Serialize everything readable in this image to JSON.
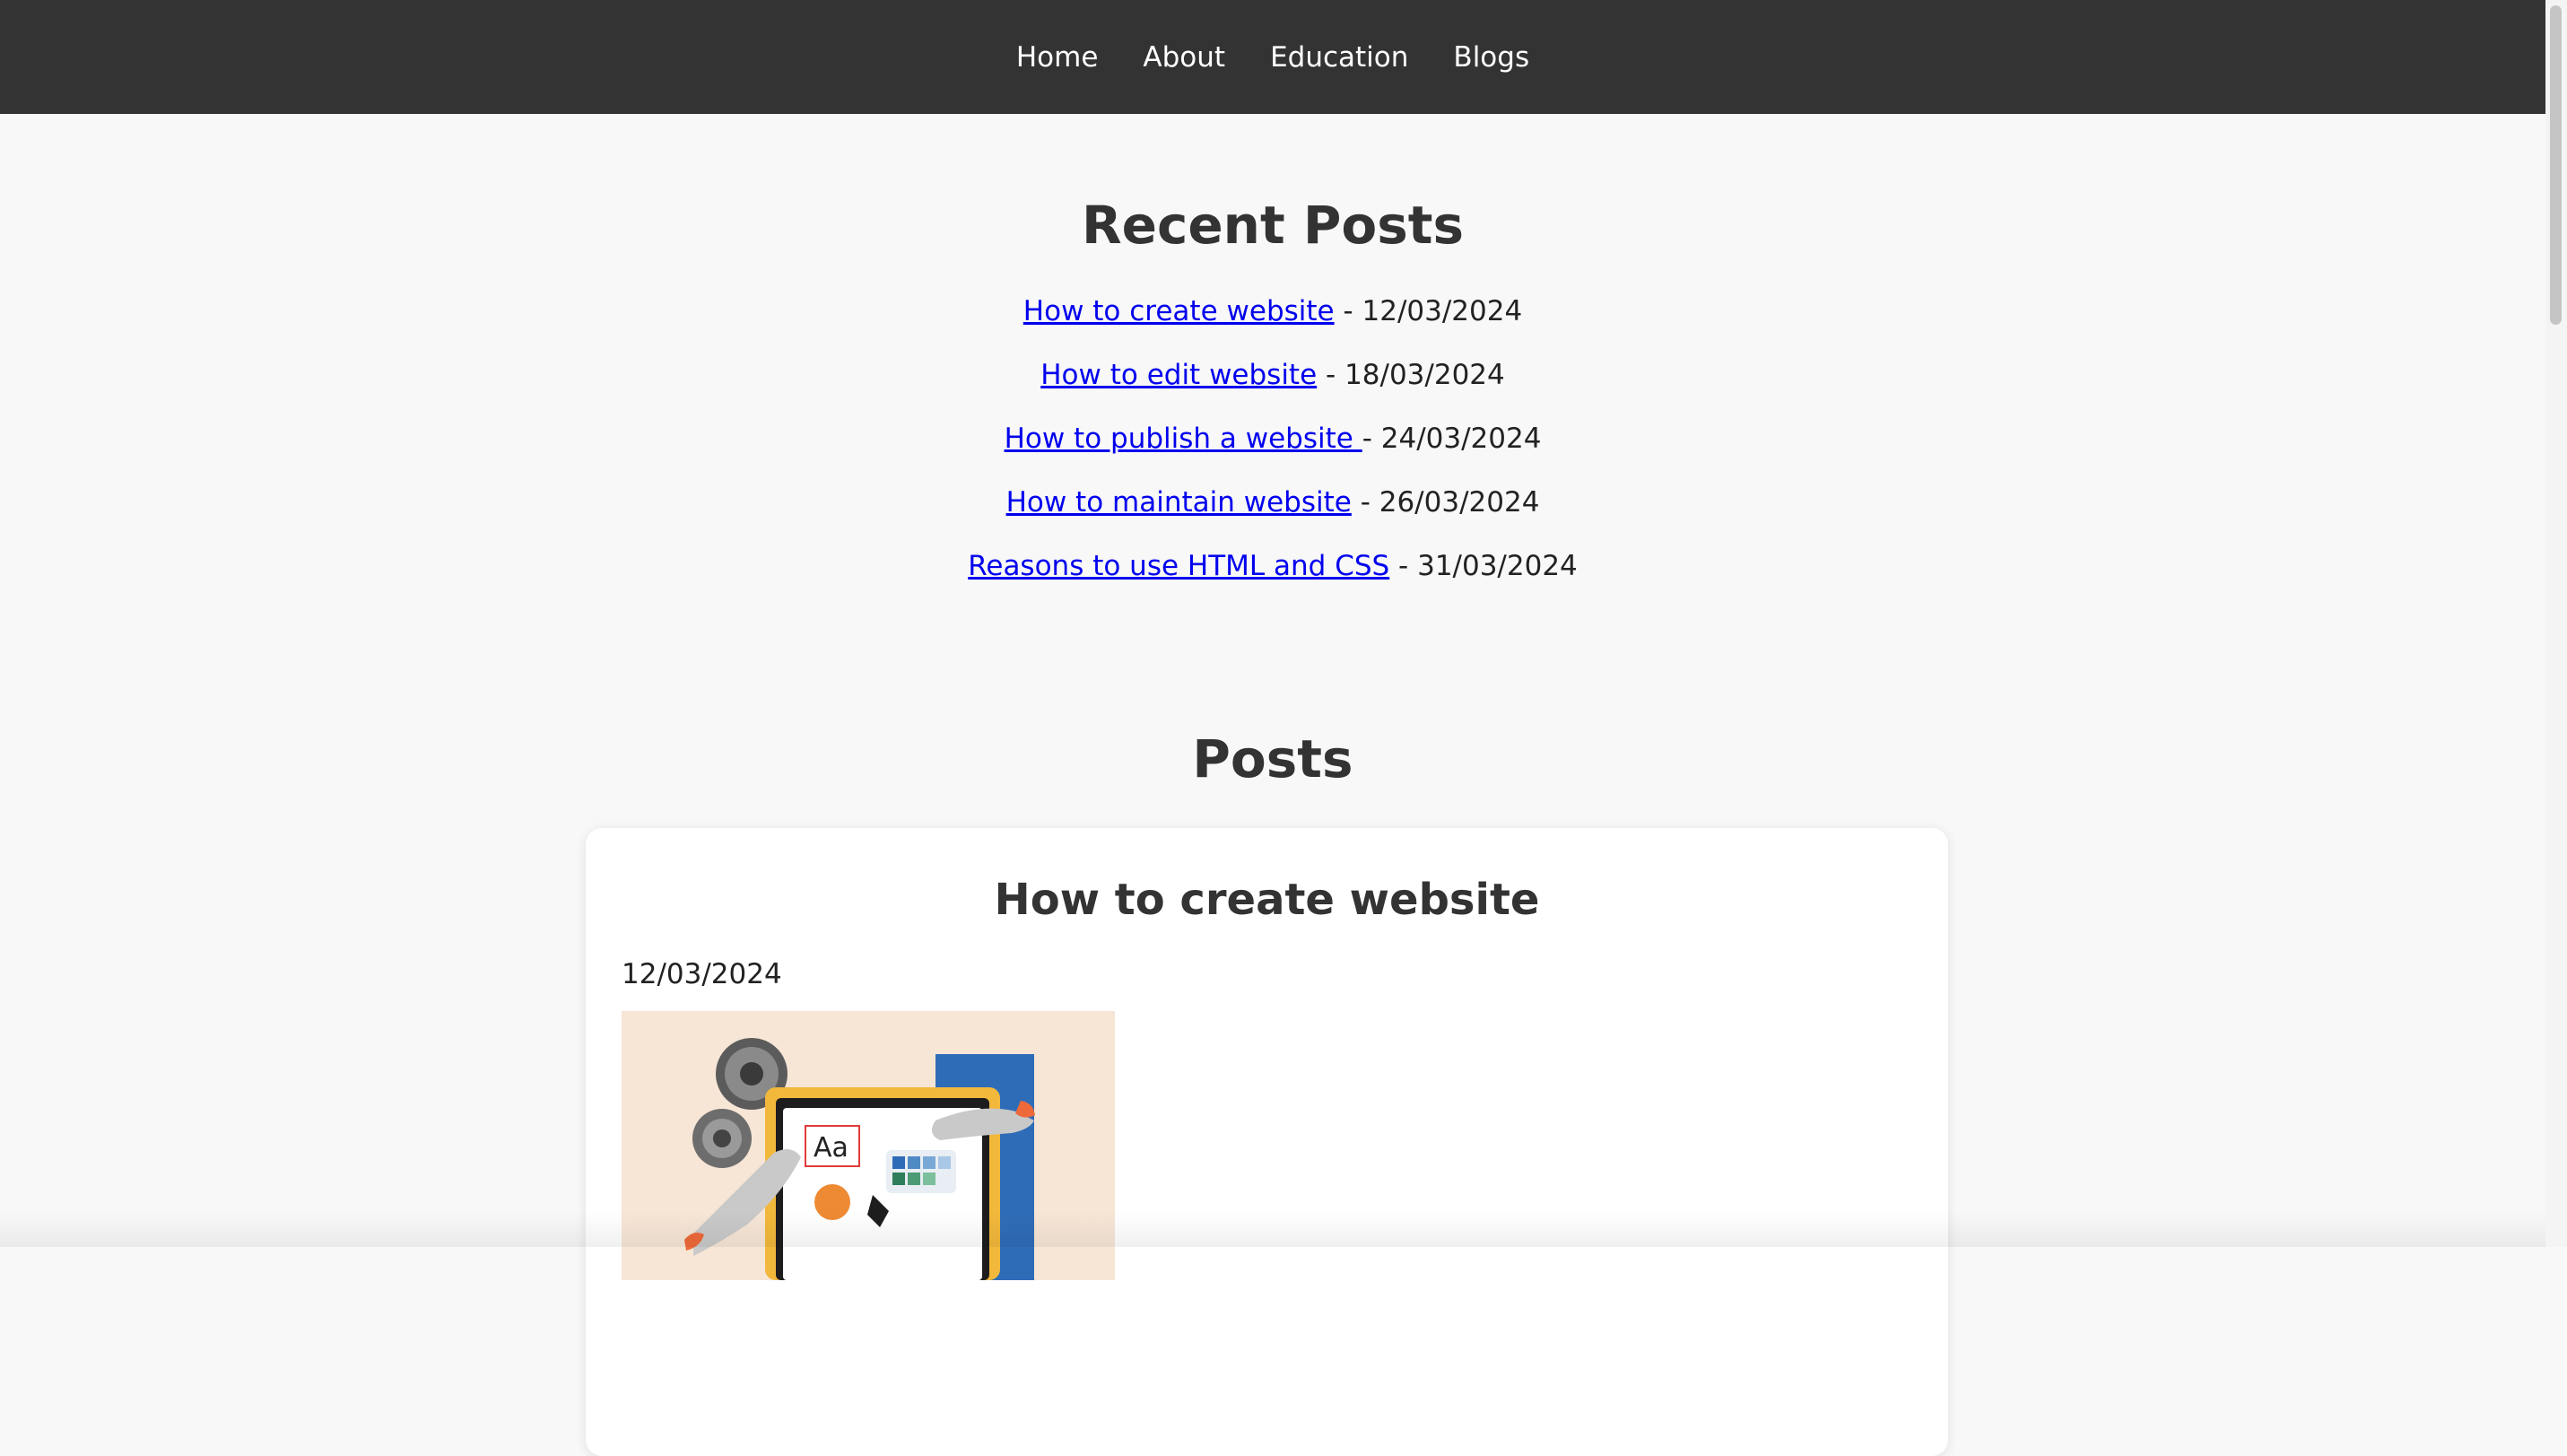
{
  "nav": {
    "items": [
      {
        "label": "Home"
      },
      {
        "label": "About"
      },
      {
        "label": "Education"
      },
      {
        "label": "Blogs"
      }
    ]
  },
  "recent": {
    "title": "Recent Posts",
    "items": [
      {
        "link": "How to create website",
        "date": " - 12/03/2024"
      },
      {
        "link": "How to edit website",
        "date": " - 18/03/2024"
      },
      {
        "link": "How to publish a website ",
        "date": "- 24/03/2024"
      },
      {
        "link": "How to maintain website",
        "date": " - 26/03/2024"
      },
      {
        "link": "Reasons to use HTML and CSS",
        "date": " - 31/03/2024"
      }
    ]
  },
  "posts": {
    "title": "Posts",
    "items": [
      {
        "title": "How to create website",
        "date": "12/03/2024",
        "image_icon": "web-design-illustration"
      }
    ]
  },
  "colors": {
    "nav_bg": "#333333",
    "page_bg": "#f8f8f8",
    "link": "#0000ee",
    "card_bg": "#ffffff",
    "illustration_bg": "#f7e6d6",
    "illustration_accent_blue": "#2f6cb8",
    "illustration_accent_yellow": "#f2b83b",
    "illustration_accent_orange": "#ee8a33"
  }
}
